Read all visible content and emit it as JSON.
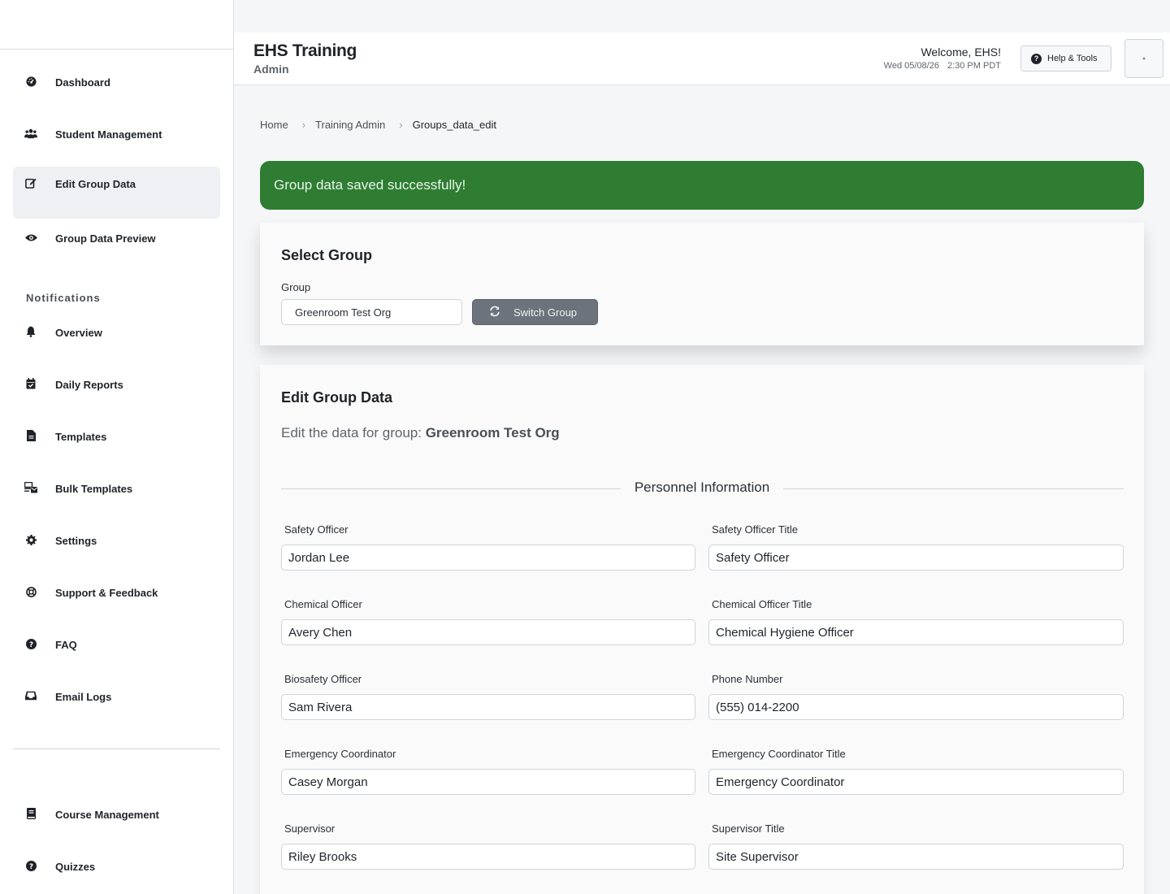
{
  "sidebar": {
    "items": [
      {
        "label": "Dashboard",
        "icon": "dashboard-icon"
      },
      {
        "label": "Student Management",
        "icon": "users-icon"
      },
      {
        "label": "Edit Group Data",
        "icon": "edit-icon",
        "active": true
      },
      {
        "label": "Group Data Preview",
        "icon": "eye-icon"
      }
    ],
    "notifications_title": "Notifications",
    "notification_items": [
      {
        "label": "Overview",
        "icon": "bell-icon"
      },
      {
        "label": "Daily Reports",
        "icon": "calendar-check-icon"
      },
      {
        "label": "Templates",
        "icon": "file-icon"
      },
      {
        "label": "Bulk Templates",
        "icon": "mail-bulk-icon"
      },
      {
        "label": "Settings",
        "icon": "gear-icon"
      },
      {
        "label": "Support & Feedback",
        "icon": "life-ring-icon"
      },
      {
        "label": "FAQ",
        "icon": "question-circle-icon"
      },
      {
        "label": "Email Logs",
        "icon": "inbox-icon"
      }
    ],
    "bottom_items": [
      {
        "label": "Course Management",
        "icon": "book-icon"
      },
      {
        "label": "Quizzes",
        "icon": "question-circle-icon"
      }
    ]
  },
  "header": {
    "title": "EHS Training",
    "subtitle": "Admin",
    "welcome": "Welcome, EHS!",
    "date": "Wed 05/08/26",
    "time": "2:30 PM PDT",
    "help_label": "Help & Tools"
  },
  "breadcrumb": [
    "Home",
    "Training Admin",
    "Groups_data_edit"
  ],
  "alert": {
    "message": "Group data saved successfully!",
    "color": "#2e7d32"
  },
  "select_group": {
    "title": "Select Group",
    "group_label": "Group",
    "group_value": "Greenroom Test Org",
    "switch_label": "Switch Group"
  },
  "edit_group": {
    "title": "Edit Group Data",
    "description_prefix": "Edit the data for group:",
    "group_name": "Greenroom Test Org",
    "section_title": "Personnel Information",
    "fields": [
      {
        "label": "Safety Officer",
        "value": "Jordan Lee"
      },
      {
        "label": "Safety Officer Title",
        "value": "Safety Officer"
      },
      {
        "label": "Chemical Officer",
        "value": "Avery Chen"
      },
      {
        "label": "Chemical Officer Title",
        "value": "Chemical Hygiene Officer"
      },
      {
        "label": "Biosafety Officer",
        "value": "Sam Rivera"
      },
      {
        "label": "Phone Number",
        "value": "(555) 014-2200"
      },
      {
        "label": "Emergency Coordinator",
        "value": "Casey Morgan"
      },
      {
        "label": "Emergency Coordinator Title",
        "value": "Emergency Coordinator"
      },
      {
        "label": "Supervisor",
        "value": "Riley Brooks"
      },
      {
        "label": "Supervisor Title",
        "value": "Site Supervisor"
      }
    ]
  }
}
